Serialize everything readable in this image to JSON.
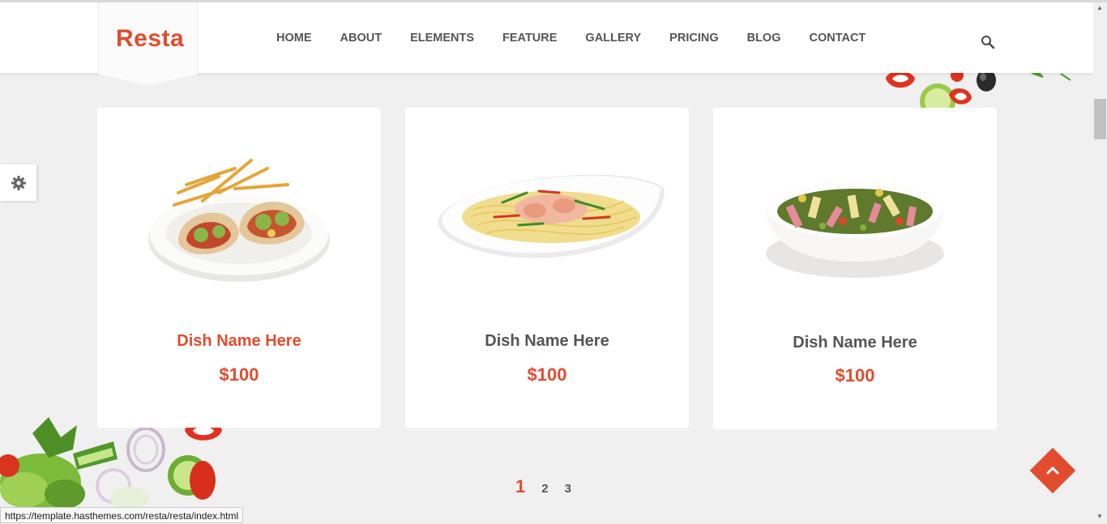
{
  "header": {
    "logo": "Resta",
    "nav": [
      "HOME",
      "ABOUT",
      "ELEMENTS",
      "FEATURE",
      "GALLERY",
      "PRICING",
      "BLOG",
      "CONTACT"
    ]
  },
  "icons": {
    "search": "search-icon",
    "settings": "gear-icon",
    "back_to_top": "chevron-up-icon"
  },
  "colors": {
    "accent": "#e14c2f",
    "text": "#555555",
    "background": "#f1f0f0"
  },
  "dishes": [
    {
      "name": "Dish Name Here",
      "price": "$100"
    },
    {
      "name": "Dish Name Here",
      "price": "$100"
    },
    {
      "name": "Dish Name Here",
      "price": "$100"
    }
  ],
  "pagination": {
    "pages": [
      "1",
      "2",
      "3"
    ],
    "current": "1"
  },
  "status_bar": {
    "url": "https://template.hasthemes.com/resta/resta/index.html"
  }
}
